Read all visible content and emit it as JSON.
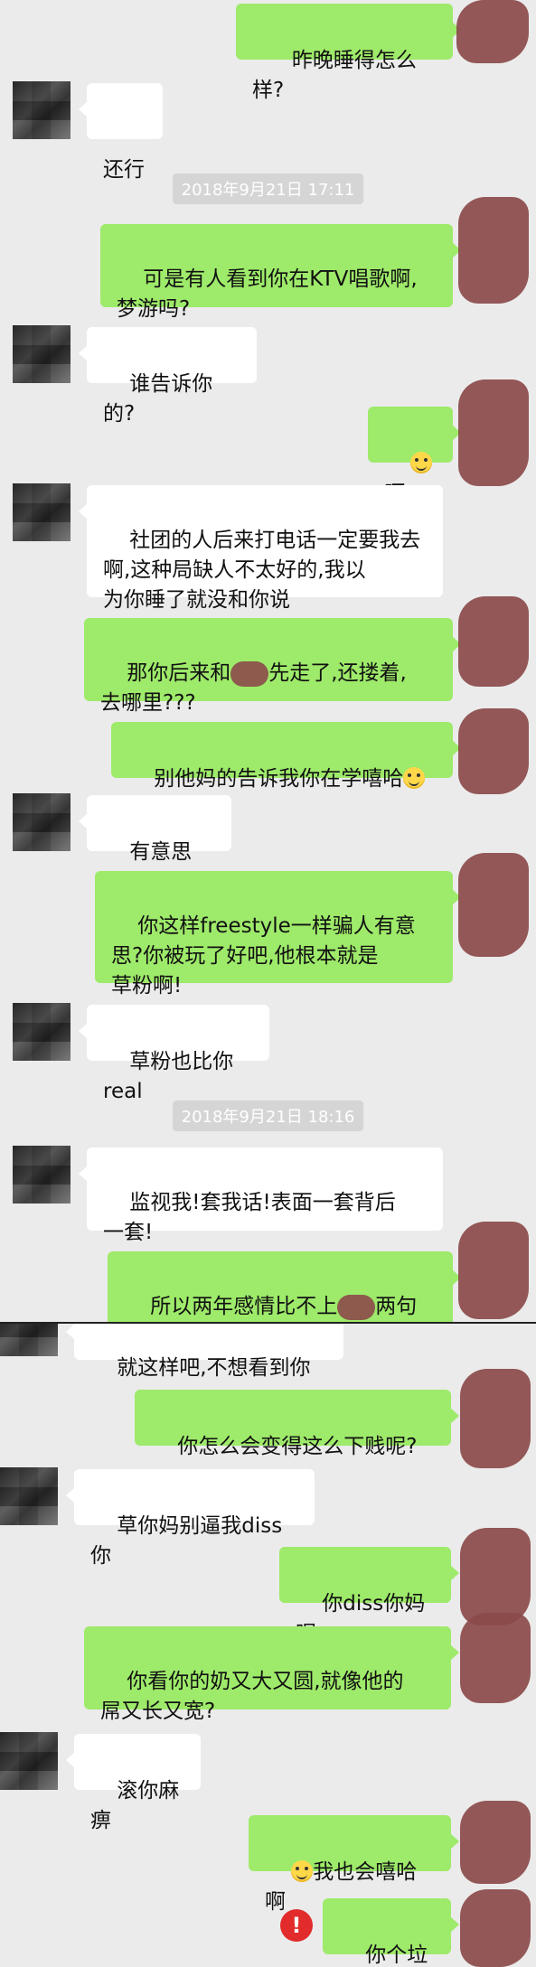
{
  "messages": [
    {
      "id": "m1",
      "side": "right",
      "text": "昨晚睡得怎么样?"
    },
    {
      "id": "m2",
      "side": "left",
      "text": "还行"
    },
    {
      "id": "t1",
      "type": "time",
      "text": "2018年9月21日 17:11"
    },
    {
      "id": "m3",
      "side": "right",
      "text": "可是有人看到你在KTV唱歌啊,\n梦游吗?"
    },
    {
      "id": "m4",
      "side": "left",
      "text": "谁告诉你的?"
    },
    {
      "id": "m5",
      "side": "right",
      "text": "呵",
      "emoji_before": true
    },
    {
      "id": "m6",
      "side": "left",
      "text": "社团的人后来打电话一定要我去\n啊,这种局缺人不太好的,我以\n为你睡了就没和你说"
    },
    {
      "id": "m7",
      "side": "right",
      "text_a": "那你后来和",
      "text_b": "先走了,还搂着,\n去哪里???"
    },
    {
      "id": "m8",
      "side": "right",
      "text": "别他妈的告诉我你在学嘻哈",
      "emoji_after": true
    },
    {
      "id": "m9",
      "side": "left",
      "text": "有意思吗?"
    },
    {
      "id": "m10",
      "side": "right",
      "text": "你这样freestyle一样骗人有意\n思?你被玩了好吧,他根本就是\n草粉啊!"
    },
    {
      "id": "m11",
      "side": "left",
      "text": "草粉也比你real"
    },
    {
      "id": "t2",
      "type": "time",
      "text": "2018年9月21日 18:16"
    },
    {
      "id": "m12",
      "side": "left",
      "text": "监视我!套我话!表面一套背后\n一套!"
    },
    {
      "id": "m13",
      "side": "right",
      "text_a": "所以两年感情比不上",
      "text_b": "两句说\n唱?见个面吧"
    },
    {
      "id": "m14",
      "side": "left",
      "text": "就这样吧,不想看到你"
    },
    {
      "id": "m15",
      "side": "right",
      "text": "你怎么会变得这么下贱呢?"
    },
    {
      "id": "m16",
      "side": "left",
      "text": "草你妈别逼我diss你"
    },
    {
      "id": "m17",
      "side": "right",
      "text": "你diss你妈呢"
    },
    {
      "id": "m18",
      "side": "right",
      "text": "你看你的奶又大又圆,就像他的\n屌又长又宽?"
    },
    {
      "id": "m19",
      "side": "left",
      "text": "滚你麻痹"
    },
    {
      "id": "m20",
      "side": "right",
      "text": "我也会嘻哈啊",
      "emoji_before": true
    },
    {
      "id": "m21",
      "side": "right",
      "text": "你个垃圾",
      "failed": true
    }
  ],
  "icons": {
    "emoji": "smile-emoji-icon",
    "error": "send-failed-icon"
  },
  "colors": {
    "green_bubble": "#9eea6a",
    "white_bubble": "#ffffff",
    "background": "#ebebeb",
    "error": "#e22b2b"
  }
}
